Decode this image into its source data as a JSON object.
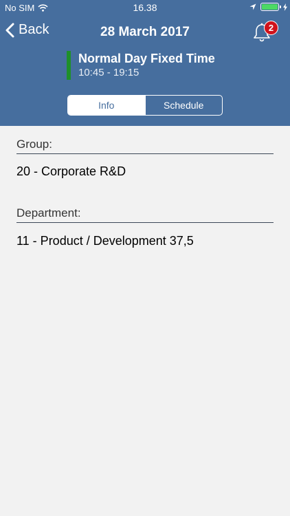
{
  "status_bar": {
    "carrier": "No SIM",
    "time": "16.38"
  },
  "nav": {
    "back_label": "Back",
    "title": "28 March 2017",
    "notification_count": "2"
  },
  "shift": {
    "name": "Normal Day Fixed Time",
    "time_range": "10:45 - 19:15",
    "color": "#1e8f2a"
  },
  "tabs": [
    {
      "label": "Info",
      "selected": true
    },
    {
      "label": "Schedule",
      "selected": false
    }
  ],
  "fields": {
    "group": {
      "label": "Group:",
      "value": "20 - Corporate R&D"
    },
    "department": {
      "label": "Department:",
      "value": "11 - Product / Development 37,5"
    }
  },
  "colors": {
    "header": "#466e9e",
    "badge": "#d0121b",
    "battery": "#4cd964",
    "background": "#f2f2f2"
  },
  "icons": [
    "wifi-icon",
    "location-arrow-icon",
    "battery-icon",
    "charging-icon",
    "chevron-left-icon",
    "bell-icon"
  ]
}
